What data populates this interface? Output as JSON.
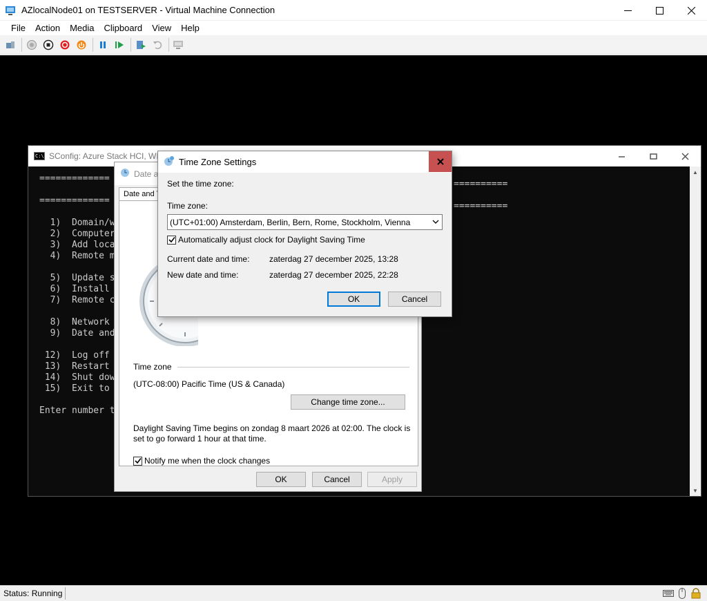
{
  "host": {
    "title": "AZlocalNode01 on TESTSERVER - Virtual Machine Connection",
    "menu": [
      "File",
      "Action",
      "Media",
      "Clipboard",
      "View",
      "Help"
    ],
    "status": "Status: Running"
  },
  "console": {
    "title": "SConfig: Azure Stack HCI, WIN",
    "lines": [
      "=============",
      "",
      "=============",
      "",
      "  1)  Domain/w",
      "  2)  Computer",
      "  3)  Add loca",
      "  4)  Remote m",
      "",
      "  5)  Update s",
      "  6)  Install",
      "  7)  Remote c",
      "",
      "  8)  Network",
      "  9)  Date and",
      "",
      " 12)  Log off",
      " 13)  Restart",
      " 14)  Shut dow",
      " 15)  Exit to",
      "",
      "Enter number t"
    ],
    "right_rule_1": "==========",
    "right_rule_2": "=========="
  },
  "date_time_dialog": {
    "title": "Date a",
    "tab": "Date and T",
    "time_zone_label": "Time zone",
    "current_time_zone": "(UTC-08:00) Pacific Time (US & Canada)",
    "change_button": "Change time zone...",
    "dst_text": "Daylight Saving Time begins on zondag 8 maart 2026 at 02:00. The clock is set to go forward 1 hour at that time.",
    "notify_label": "Notify me when the clock changes",
    "notify_checked": true,
    "ok": "OK",
    "cancel": "Cancel",
    "apply": "Apply"
  },
  "tz_dialog": {
    "title": "Time Zone Settings",
    "intro": "Set the time zone:",
    "time_zone_label": "Time zone:",
    "selected_zone": "(UTC+01:00) Amsterdam, Berlin, Bern, Rome, Stockholm, Vienna",
    "auto_dst_label": "Automatically adjust clock for Daylight Saving Time",
    "auto_dst_checked": true,
    "current_label": "Current date and time:",
    "current_value": "zaterdag 27 december 2025, 13:28",
    "new_label": "New date and time:",
    "new_value": "zaterdag 27 december 2025, 22:28",
    "ok": "OK",
    "cancel": "Cancel"
  },
  "colors": {
    "close_red": "#c75050",
    "accent_blue": "#0078d7",
    "console_bg": "#0c0c0c"
  }
}
